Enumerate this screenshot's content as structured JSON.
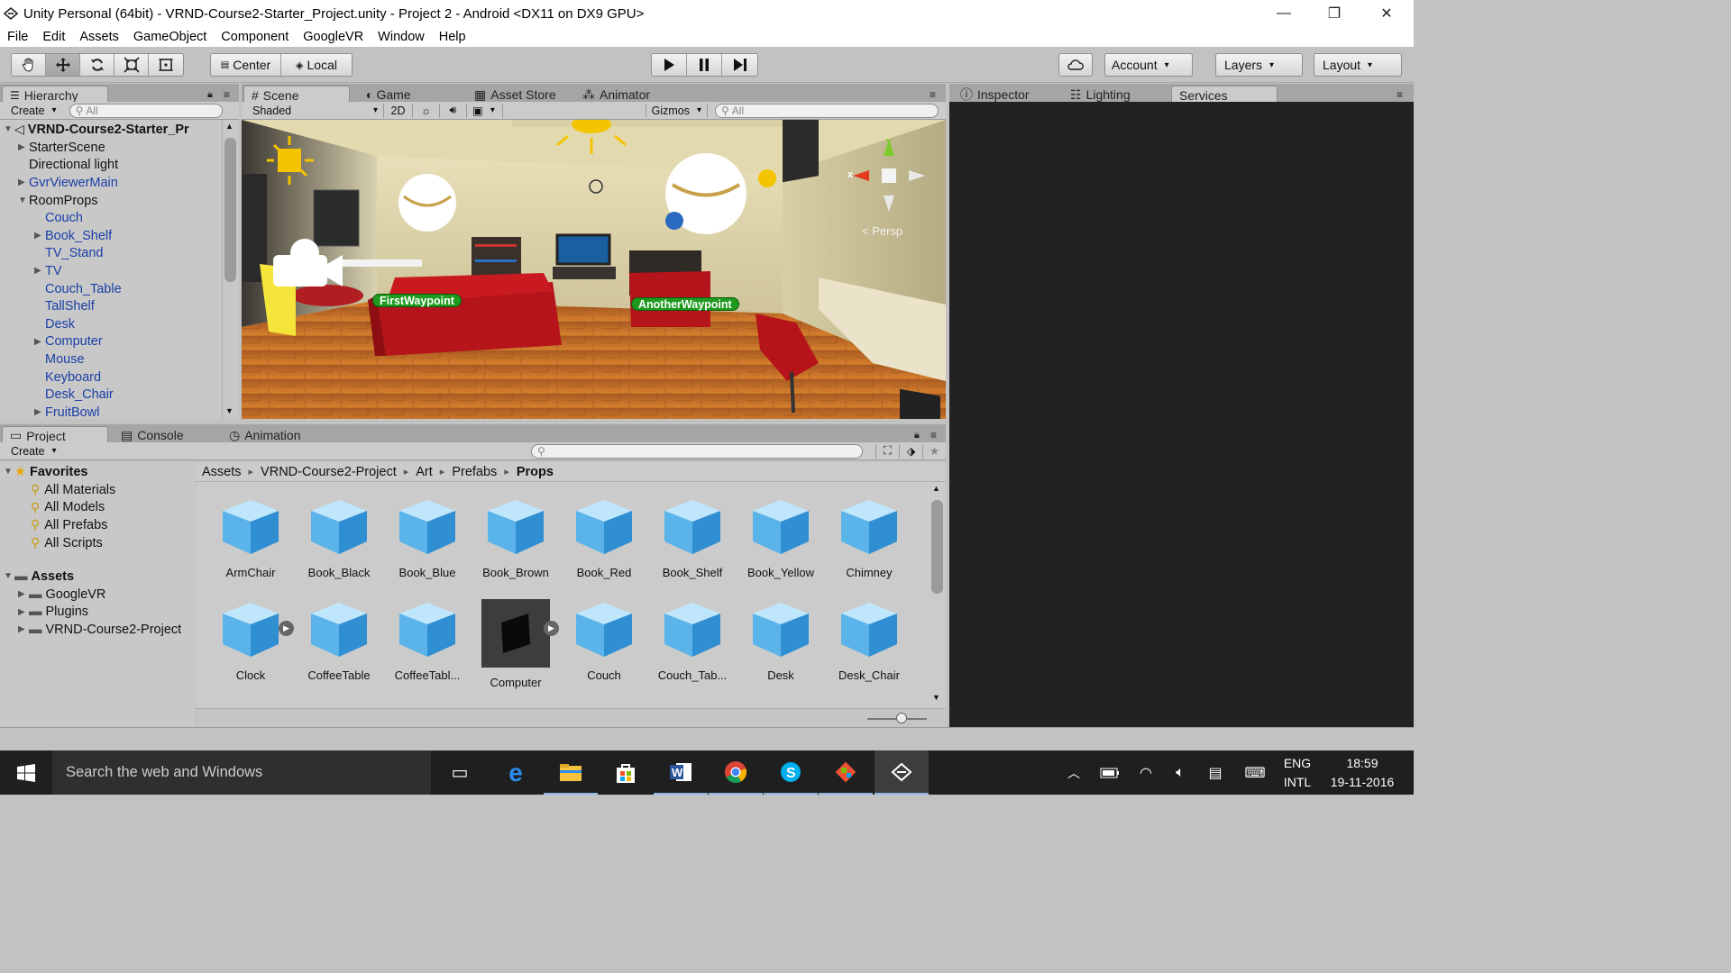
{
  "window": {
    "title": "Unity Personal (64bit) - VRND-Course2-Starter_Project.unity - Project 2 - Android <DX11 on DX9 GPU>",
    "controls": [
      "minimize-icon",
      "restore-icon",
      "close-icon"
    ]
  },
  "menu": [
    "File",
    "Edit",
    "Assets",
    "GameObject",
    "Component",
    "GoogleVR",
    "Window",
    "Help"
  ],
  "toolbar": {
    "tools": [
      "hand-icon",
      "move-icon",
      "rotate-icon",
      "scale-icon",
      "rect-tool-icon"
    ],
    "pivot": "Center",
    "space": "Local",
    "play": [
      "play-icon",
      "pause-icon",
      "step-icon"
    ],
    "account": "Account",
    "layers": "Layers",
    "layout": "Layout"
  },
  "hierarchy": {
    "tab": "Hierarchy",
    "create": "Create",
    "search_placeholder": "All",
    "root": "VRND-Course2-Starter_Pr",
    "items": [
      {
        "label": "StarterScene",
        "indent": 1,
        "arrow": "right",
        "blue": false
      },
      {
        "label": "Directional light",
        "indent": 1,
        "arrow": "",
        "blue": false
      },
      {
        "label": "GvrViewerMain",
        "indent": 1,
        "arrow": "right",
        "blue": true
      },
      {
        "label": "RoomProps",
        "indent": 1,
        "arrow": "down",
        "blue": false
      },
      {
        "label": "Couch",
        "indent": 2,
        "arrow": "",
        "blue": true
      },
      {
        "label": "Book_Shelf",
        "indent": 2,
        "arrow": "right",
        "blue": true
      },
      {
        "label": "TV_Stand",
        "indent": 2,
        "arrow": "",
        "blue": true
      },
      {
        "label": "TV",
        "indent": 2,
        "arrow": "right",
        "blue": true
      },
      {
        "label": "Couch_Table",
        "indent": 2,
        "arrow": "",
        "blue": true
      },
      {
        "label": "TallShelf",
        "indent": 2,
        "arrow": "",
        "blue": true
      },
      {
        "label": "Desk",
        "indent": 2,
        "arrow": "",
        "blue": true
      },
      {
        "label": "Computer",
        "indent": 2,
        "arrow": "right",
        "blue": true
      },
      {
        "label": "Mouse",
        "indent": 2,
        "arrow": "",
        "blue": true
      },
      {
        "label": "Keyboard",
        "indent": 2,
        "arrow": "",
        "blue": true
      },
      {
        "label": "Desk_Chair",
        "indent": 2,
        "arrow": "",
        "blue": true
      },
      {
        "label": "FruitBowl",
        "indent": 2,
        "arrow": "right",
        "blue": true
      }
    ]
  },
  "scene": {
    "tabs": [
      "Scene",
      "Game",
      "Asset Store",
      "Animator"
    ],
    "shading": "Shaded",
    "mode_2d": "2D",
    "gizmos": "Gizmos",
    "search_placeholder": "All",
    "persp": "< Persp",
    "axis_y": "y",
    "axis_x": "x",
    "waypoints": [
      "FirstWaypoint",
      "AnotherWaypoint"
    ]
  },
  "right_panel": {
    "tabs": [
      "Inspector",
      "Lighting",
      "Services"
    ]
  },
  "project": {
    "tabs": [
      "Project",
      "Console",
      "Animation"
    ],
    "create": "Create",
    "favorites_label": "Favorites",
    "favorites": [
      "All Materials",
      "All Models",
      "All Prefabs",
      "All Scripts"
    ],
    "assets_label": "Assets",
    "folders": [
      "GoogleVR",
      "Plugins",
      "VRND-Course2-Project"
    ],
    "breadcrumb": [
      "Assets",
      "VRND-Course2-Project",
      "Art",
      "Prefabs",
      "Props"
    ],
    "row1": [
      "ArmChair",
      "Book_Black",
      "Book_Blue",
      "Book_Brown",
      "Book_Red",
      "Book_Shelf",
      "Book_Yellow",
      "Chimney"
    ],
    "row2": [
      "Clock",
      "CoffeeTable",
      "CoffeeTabl...",
      "Computer",
      "Couch",
      "Couch_Tab...",
      "Desk",
      "Desk_Chair"
    ]
  },
  "taskbar": {
    "search_placeholder": "Search the web and Windows",
    "apps": [
      "task-view-icon",
      "edge-icon",
      "file-explorer-icon",
      "store-icon",
      "word-icon",
      "chrome-icon",
      "skype-icon",
      "git-icon",
      "unity-icon"
    ],
    "lang1": "ENG",
    "lang2": "INTL",
    "time": "18:59",
    "date": "19-11-2016"
  },
  "colors": {
    "accent_blue": "#1a3fa8",
    "waypoint_green": "#1e9a1e",
    "panel_bg": "#c2c2c2",
    "inspector_bg": "#222222",
    "couch_red": "#b5141a"
  }
}
